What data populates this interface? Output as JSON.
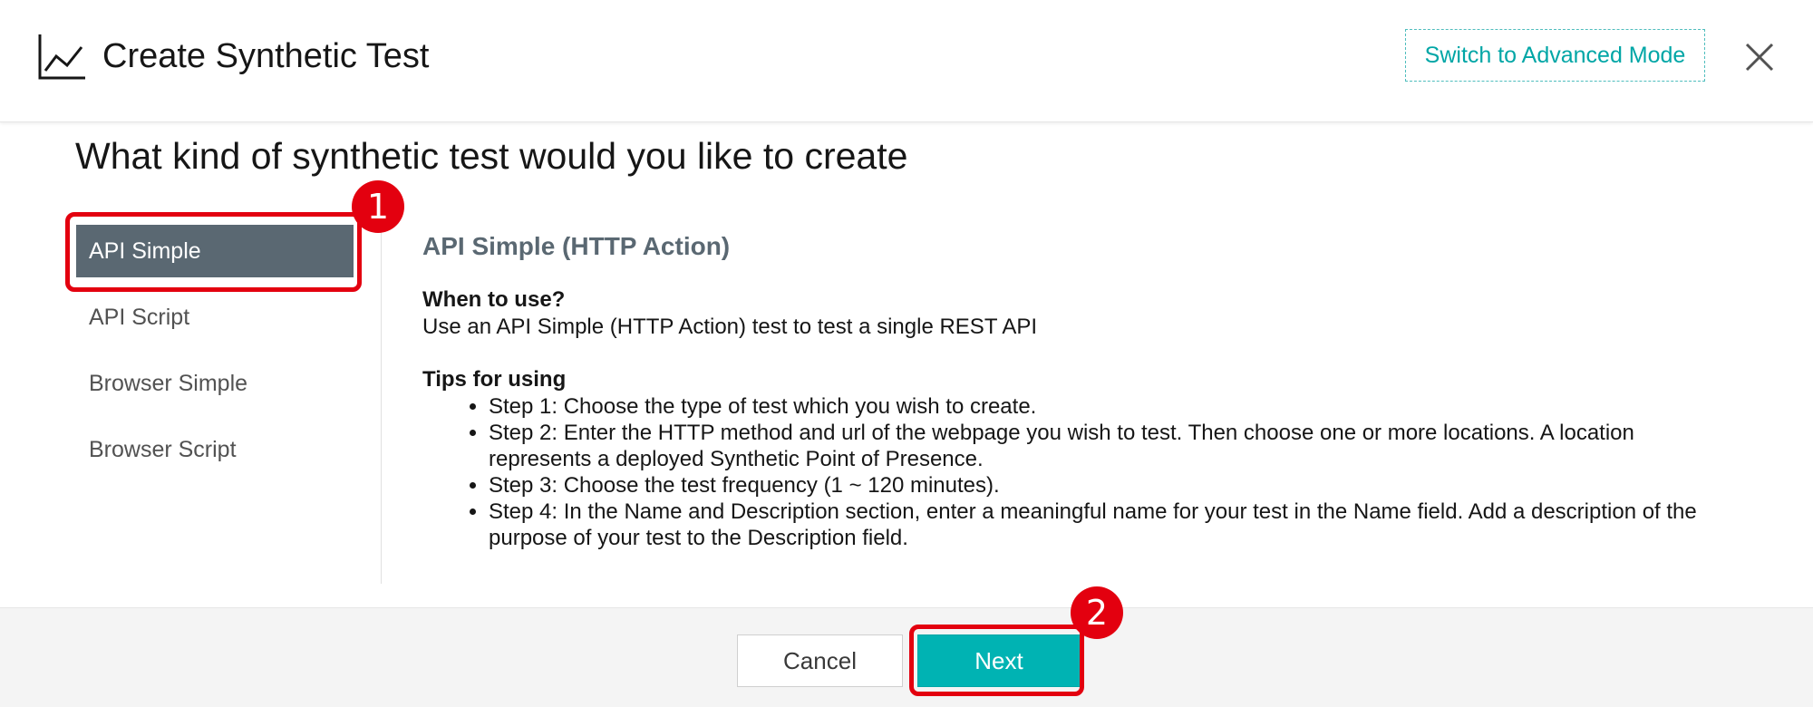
{
  "header": {
    "title": "Create Synthetic Test",
    "advanced_mode_label": "Switch to Advanced Mode"
  },
  "question": "What kind of synthetic test would you like to create",
  "sidebar": {
    "items": [
      {
        "label": "API Simple",
        "selected": true
      },
      {
        "label": "API Script",
        "selected": false
      },
      {
        "label": "Browser Simple",
        "selected": false
      },
      {
        "label": "Browser Script",
        "selected": false
      }
    ]
  },
  "content": {
    "title": "API Simple (HTTP Action)",
    "when_heading": "When to use?",
    "when_text": "Use an API Simple (HTTP Action) test to test a single REST API",
    "tips_heading": "Tips for using",
    "tips": [
      "Step 1: Choose the type of test which you wish to create.",
      "Step 2: Enter the HTTP method and url of the webpage you wish to test. Then choose one or more locations. A location represents a deployed Synthetic Point of Presence.",
      "Step 3: Choose the test frequency (1 ~ 120 minutes).",
      "Step 4: In the Name and Description section, enter a meaningful name for your test in the Name field. Add a description of the purpose of your test to the Description field."
    ]
  },
  "footer": {
    "cancel_label": "Cancel",
    "next_label": "Next"
  },
  "annotations": {
    "first": "1",
    "second": "2"
  },
  "colors": {
    "accent": "#00b3b3",
    "selected_bg": "#5a6872",
    "callout": "#e3000f"
  }
}
